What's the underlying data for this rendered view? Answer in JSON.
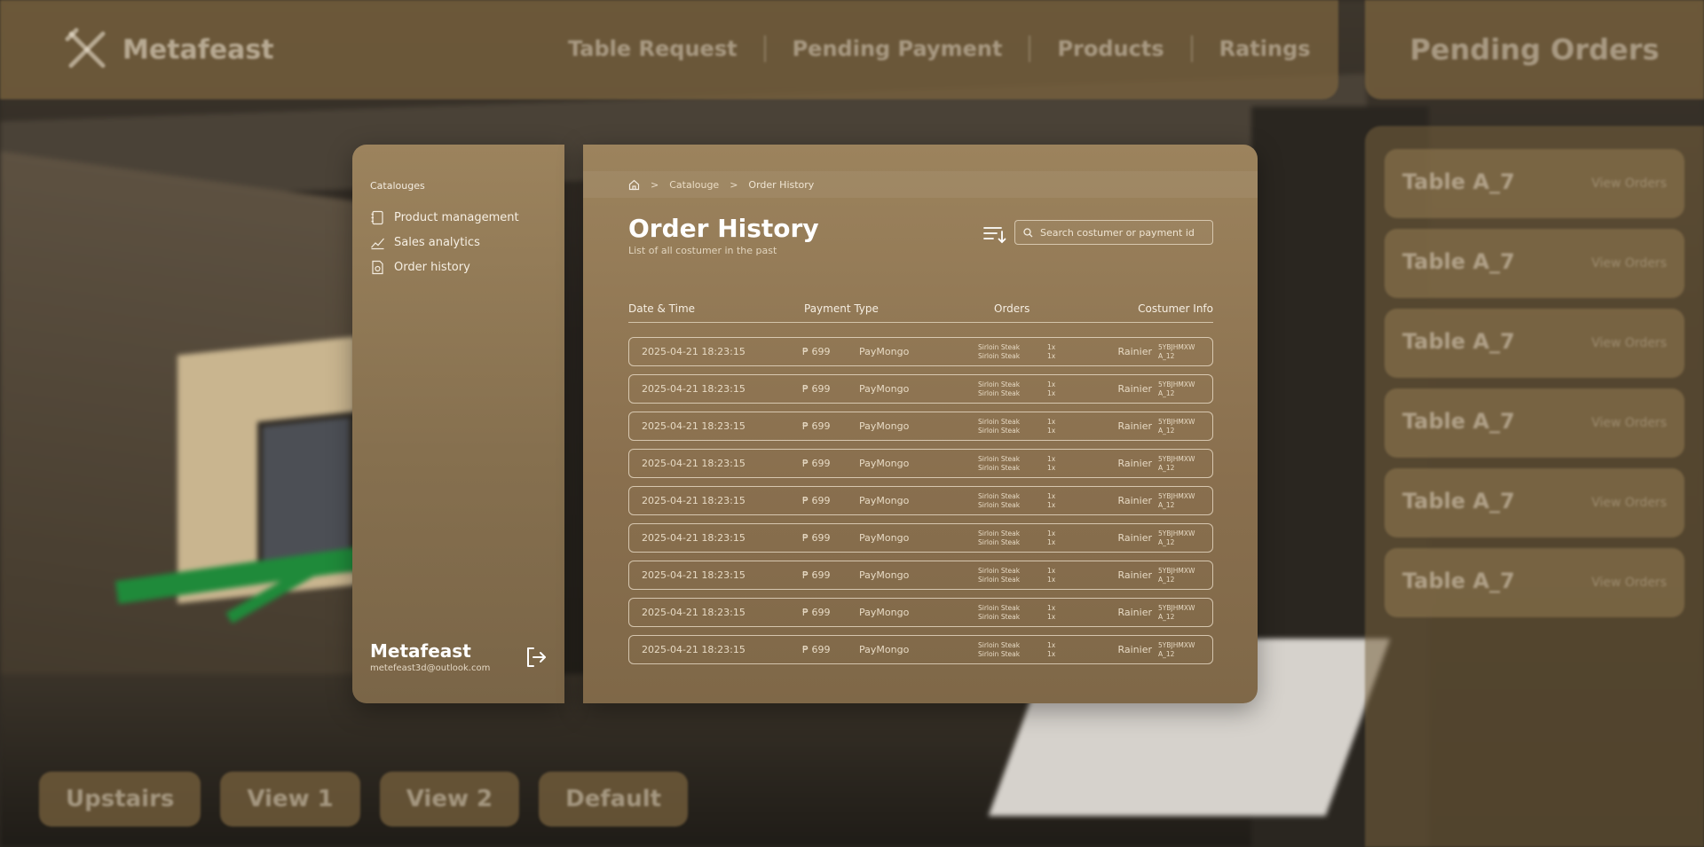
{
  "topbar": {
    "brand": "Metafeast",
    "nav": [
      "Table Request",
      "Pending Payment",
      "Products",
      "Ratings"
    ]
  },
  "pending": {
    "title": "Pending Orders",
    "cards": [
      {
        "title": "Table A_7",
        "sub": "",
        "view": "View Orders"
      },
      {
        "title": "Table A_7",
        "sub": "",
        "view": "View Orders"
      },
      {
        "title": "Table A_7",
        "sub": "",
        "view": "View Orders"
      },
      {
        "title": "Table A_7",
        "sub": "",
        "view": "View Orders"
      },
      {
        "title": "Table A_7",
        "sub": "",
        "view": "View Orders"
      },
      {
        "title": "Table A_7",
        "sub": "",
        "view": "View Orders"
      }
    ]
  },
  "camera": {
    "buttons": [
      "Upstairs",
      "View 1",
      "View 2",
      "Default"
    ]
  },
  "sidebar": {
    "section": "Catalouges",
    "items": [
      {
        "label": "Product management",
        "icon": "notebook-icon"
      },
      {
        "label": "Sales analytics",
        "icon": "chart-line-icon"
      },
      {
        "label": "Order history",
        "icon": "receipt-icon"
      }
    ],
    "footer": {
      "name": "Metafeast",
      "email": "metefeast3d@outlook.com"
    }
  },
  "breadcrumb": {
    "parent": "Catalouge",
    "current": "Order History",
    "sep": ">"
  },
  "page": {
    "title": "Order History",
    "subtitle": "List of all costumer in the past",
    "search_placeholder": "Search costumer or payment id"
  },
  "table": {
    "headers": {
      "date": "Date & Time",
      "payment": "Payment Type",
      "orders": "Orders",
      "info": "Costumer Info"
    },
    "rows": [
      {
        "datetime": "2025-04-21 18:23:15",
        "amount": "₱ 699",
        "method": "PayMongo",
        "item1": "Sirloin Steak",
        "item2": "Sirloin Steak",
        "qty1": "1x",
        "qty2": "1x",
        "customer": "Rainier",
        "id1": "5YBJHMXW",
        "id2": "A_12"
      },
      {
        "datetime": "2025-04-21 18:23:15",
        "amount": "₱ 699",
        "method": "PayMongo",
        "item1": "Sirloin Steak",
        "item2": "Sirloin Steak",
        "qty1": "1x",
        "qty2": "1x",
        "customer": "Rainier",
        "id1": "5YBJHMXW",
        "id2": "A_12"
      },
      {
        "datetime": "2025-04-21 18:23:15",
        "amount": "₱ 699",
        "method": "PayMongo",
        "item1": "Sirloin Steak",
        "item2": "Sirloin Steak",
        "qty1": "1x",
        "qty2": "1x",
        "customer": "Rainier",
        "id1": "5YBJHMXW",
        "id2": "A_12"
      },
      {
        "datetime": "2025-04-21 18:23:15",
        "amount": "₱ 699",
        "method": "PayMongo",
        "item1": "Sirloin Steak",
        "item2": "Sirloin Steak",
        "qty1": "1x",
        "qty2": "1x",
        "customer": "Rainier",
        "id1": "5YBJHMXW",
        "id2": "A_12"
      },
      {
        "datetime": "2025-04-21 18:23:15",
        "amount": "₱ 699",
        "method": "PayMongo",
        "item1": "Sirloin Steak",
        "item2": "Sirloin Steak",
        "qty1": "1x",
        "qty2": "1x",
        "customer": "Rainier",
        "id1": "5YBJHMXW",
        "id2": "A_12"
      },
      {
        "datetime": "2025-04-21 18:23:15",
        "amount": "₱ 699",
        "method": "PayMongo",
        "item1": "Sirloin Steak",
        "item2": "Sirloin Steak",
        "qty1": "1x",
        "qty2": "1x",
        "customer": "Rainier",
        "id1": "5YBJHMXW",
        "id2": "A_12"
      },
      {
        "datetime": "2025-04-21 18:23:15",
        "amount": "₱ 699",
        "method": "PayMongo",
        "item1": "Sirloin Steak",
        "item2": "Sirloin Steak",
        "qty1": "1x",
        "qty2": "1x",
        "customer": "Rainier",
        "id1": "5YBJHMXW",
        "id2": "A_12"
      },
      {
        "datetime": "2025-04-21 18:23:15",
        "amount": "₱ 699",
        "method": "PayMongo",
        "item1": "Sirloin Steak",
        "item2": "Sirloin Steak",
        "qty1": "1x",
        "qty2": "1x",
        "customer": "Rainier",
        "id1": "5YBJHMXW",
        "id2": "A_12"
      },
      {
        "datetime": "2025-04-21 18:23:15",
        "amount": "₱ 699",
        "method": "PayMongo",
        "item1": "Sirloin Steak",
        "item2": "Sirloin Steak",
        "qty1": "1x",
        "qty2": "1x",
        "customer": "Rainier",
        "id1": "5YBJHMXW",
        "id2": "A_12"
      }
    ]
  },
  "colors": {
    "panel": "#9c835d",
    "panel_dark": "#7a6547",
    "text": "#f3ece0",
    "accent_green": "#1f8a3a"
  }
}
